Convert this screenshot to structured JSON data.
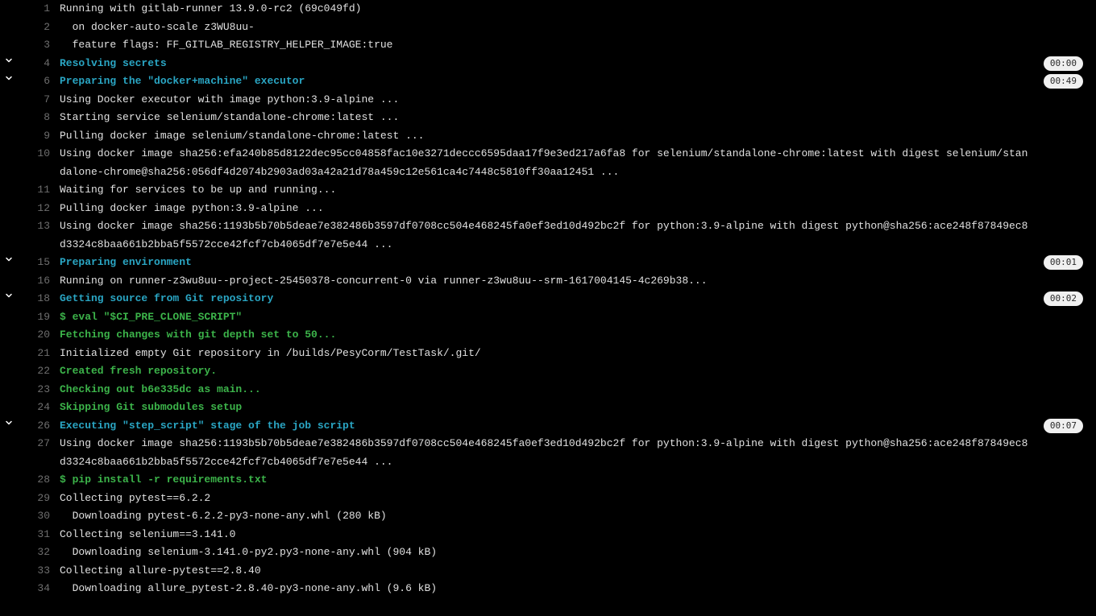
{
  "lines": [
    {
      "n": 1,
      "style": "plain",
      "text": "Running with gitlab-runner 13.9.0-rc2 (69c049fd)"
    },
    {
      "n": 2,
      "style": "plain",
      "text": "  on docker-auto-scale z3WU8uu-"
    },
    {
      "n": 3,
      "style": "plain",
      "text": "  feature flags: FF_GITLAB_REGISTRY_HELPER_IMAGE:true"
    },
    {
      "n": 4,
      "style": "cyan",
      "section": true,
      "time": "00:00",
      "text": "Resolving secrets"
    },
    {
      "n": 6,
      "style": "cyan",
      "section": true,
      "time": "00:49",
      "text": "Preparing the \"docker+machine\" executor"
    },
    {
      "n": 7,
      "style": "plain",
      "text": "Using Docker executor with image python:3.9-alpine ..."
    },
    {
      "n": 8,
      "style": "plain",
      "text": "Starting service selenium/standalone-chrome:latest ..."
    },
    {
      "n": 9,
      "style": "plain",
      "text": "Pulling docker image selenium/standalone-chrome:latest ..."
    },
    {
      "n": 10,
      "style": "plain",
      "text": "Using docker image sha256:efa240b85d8122dec95cc04858fac10e3271deccc6595daa17f9e3ed217a6fa8 for selenium/standalone-chrome:latest with digest selenium/standalone-chrome@sha256:056df4d2074b2903ad03a42a21d78a459c12e561ca4c7448c5810ff30aa12451 ..."
    },
    {
      "n": 11,
      "style": "plain",
      "text": "Waiting for services to be up and running..."
    },
    {
      "n": 12,
      "style": "plain",
      "text": "Pulling docker image python:3.9-alpine ..."
    },
    {
      "n": 13,
      "style": "plain",
      "text": "Using docker image sha256:1193b5b70b5deae7e382486b3597df0708cc504e468245fa0ef3ed10d492bc2f for python:3.9-alpine with digest python@sha256:ace248f87849ec8d3324c8baa661b2bba5f5572cce42fcf7cb4065df7e7e5e44 ..."
    },
    {
      "n": 15,
      "style": "cyan",
      "section": true,
      "time": "00:01",
      "text": "Preparing environment"
    },
    {
      "n": 16,
      "style": "plain",
      "text": "Running on runner-z3wu8uu--project-25450378-concurrent-0 via runner-z3wu8uu--srm-1617004145-4c269b38..."
    },
    {
      "n": 18,
      "style": "cyan",
      "section": true,
      "time": "00:02",
      "text": "Getting source from Git repository"
    },
    {
      "n": 19,
      "style": "green",
      "text": "$ eval \"$CI_PRE_CLONE_SCRIPT\""
    },
    {
      "n": 20,
      "style": "green",
      "text": "Fetching changes with git depth set to 50..."
    },
    {
      "n": 21,
      "style": "plain",
      "text": "Initialized empty Git repository in /builds/PesyCorm/TestTask/.git/"
    },
    {
      "n": 22,
      "style": "green",
      "text": "Created fresh repository."
    },
    {
      "n": 23,
      "style": "green",
      "text": "Checking out b6e335dc as main..."
    },
    {
      "n": 24,
      "style": "green",
      "text": "Skipping Git submodules setup"
    },
    {
      "n": 26,
      "style": "cyan",
      "section": true,
      "time": "00:07",
      "text": "Executing \"step_script\" stage of the job script"
    },
    {
      "n": 27,
      "style": "plain",
      "text": "Using docker image sha256:1193b5b70b5deae7e382486b3597df0708cc504e468245fa0ef3ed10d492bc2f for python:3.9-alpine with digest python@sha256:ace248f87849ec8d3324c8baa661b2bba5f5572cce42fcf7cb4065df7e7e5e44 ..."
    },
    {
      "n": 28,
      "style": "green",
      "text": "$ pip install -r requirements.txt"
    },
    {
      "n": 29,
      "style": "plain",
      "text": "Collecting pytest==6.2.2"
    },
    {
      "n": 30,
      "style": "plain",
      "text": "  Downloading pytest-6.2.2-py3-none-any.whl (280 kB)"
    },
    {
      "n": 31,
      "style": "plain",
      "text": "Collecting selenium==3.141.0"
    },
    {
      "n": 32,
      "style": "plain",
      "text": "  Downloading selenium-3.141.0-py2.py3-none-any.whl (904 kB)"
    },
    {
      "n": 33,
      "style": "plain",
      "text": "Collecting allure-pytest==2.8.40"
    },
    {
      "n": 34,
      "style": "plain",
      "text": "  Downloading allure_pytest-2.8.40-py3-none-any.whl (9.6 kB)"
    }
  ]
}
